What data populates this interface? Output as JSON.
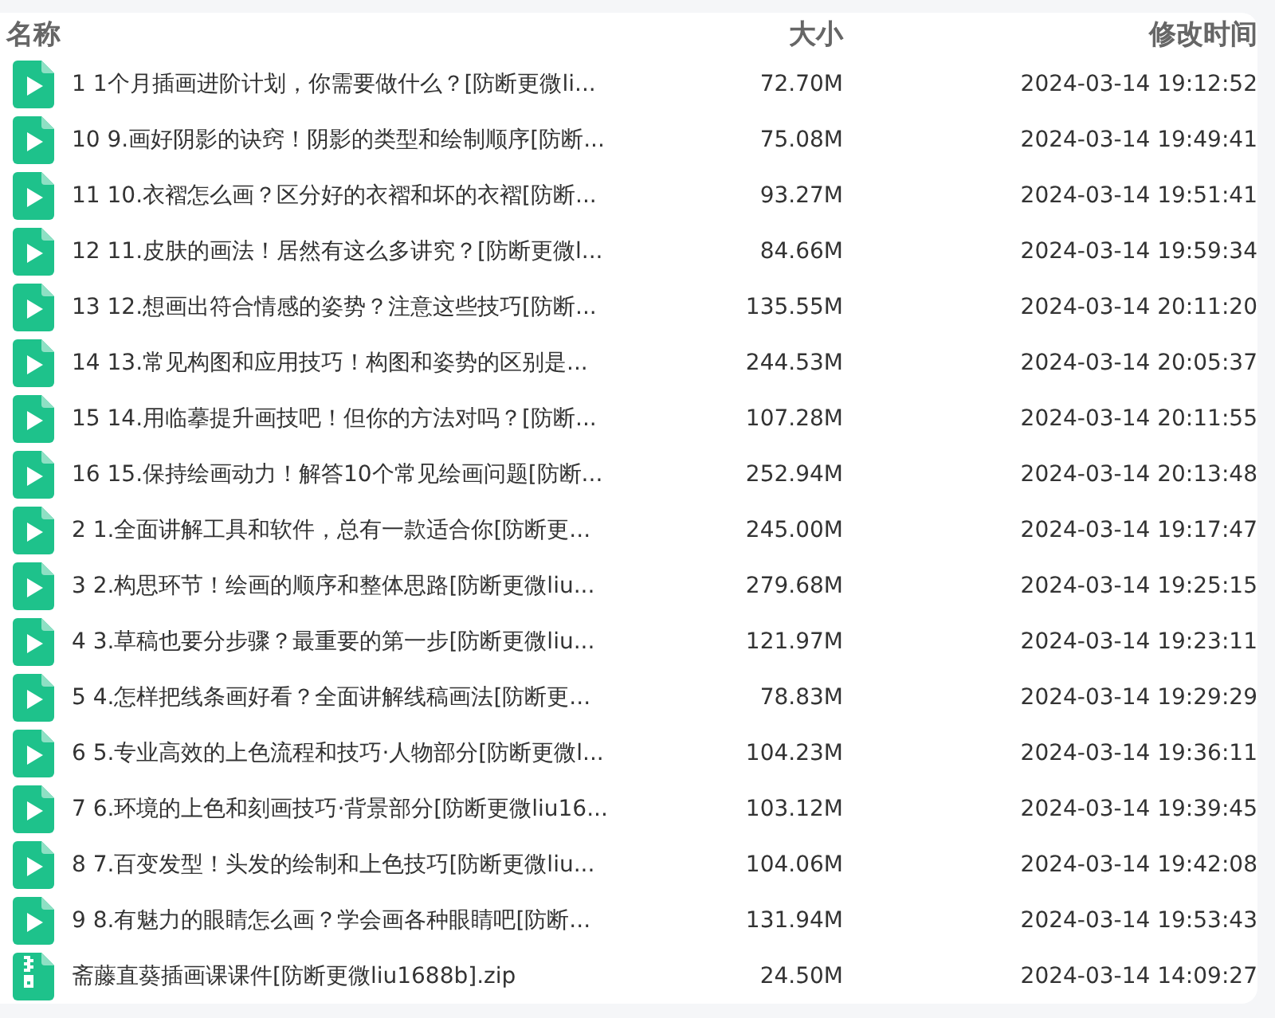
{
  "table": {
    "columns": [
      "名称",
      "大小",
      "修改时间"
    ],
    "rows": [
      {
        "kind": "video",
        "name": "1 1个月插画进阶计划，你需要做什么？[防断更微li...",
        "size": "72.70M",
        "modified": "2024-03-14 19:12:52"
      },
      {
        "kind": "video",
        "name": "10 9.画好阴影的诀窍！阴影的类型和绘制顺序[防断...",
        "size": "75.08M",
        "modified": "2024-03-14 19:49:41"
      },
      {
        "kind": "video",
        "name": "11 10.衣褶怎么画？区分好的衣褶和坏的衣褶[防断...",
        "size": "93.27M",
        "modified": "2024-03-14 19:51:41"
      },
      {
        "kind": "video",
        "name": "12 11.皮肤的画法！居然有这么多讲究？[防断更微l...",
        "size": "84.66M",
        "modified": "2024-03-14 19:59:34"
      },
      {
        "kind": "video",
        "name": "13 12.想画出符合情感的姿势？注意这些技巧[防断...",
        "size": "135.55M",
        "modified": "2024-03-14 20:11:20"
      },
      {
        "kind": "video",
        "name": "14 13.常见构图和应用技巧！构图和姿势的区别是...",
        "size": "244.53M",
        "modified": "2024-03-14 20:05:37"
      },
      {
        "kind": "video",
        "name": "15 14.用临摹提升画技吧！但你的方法对吗？[防断...",
        "size": "107.28M",
        "modified": "2024-03-14 20:11:55"
      },
      {
        "kind": "video",
        "name": "16 15.保持绘画动力！解答10个常见绘画问题[防断...",
        "size": "252.94M",
        "modified": "2024-03-14 20:13:48"
      },
      {
        "kind": "video",
        "name": "2 1.全面讲解工具和软件，总有一款适合你[防断更...",
        "size": "245.00M",
        "modified": "2024-03-14 19:17:47"
      },
      {
        "kind": "video",
        "name": "3 2.构思环节！绘画的顺序和整体思路[防断更微liu...",
        "size": "279.68M",
        "modified": "2024-03-14 19:25:15"
      },
      {
        "kind": "video",
        "name": "4 3.草稿也要分步骤？最重要的第一步[防断更微liu...",
        "size": "121.97M",
        "modified": "2024-03-14 19:23:11"
      },
      {
        "kind": "video",
        "name": "5 4.怎样把线条画好看？全面讲解线稿画法[防断更...",
        "size": "78.83M",
        "modified": "2024-03-14 19:29:29"
      },
      {
        "kind": "video",
        "name": "6 5.专业高效的上色流程和技巧·人物部分[防断更微l...",
        "size": "104.23M",
        "modified": "2024-03-14 19:36:11"
      },
      {
        "kind": "video",
        "name": "7 6.环境的上色和刻画技巧·背景部分[防断更微liu16...",
        "size": "103.12M",
        "modified": "2024-03-14 19:39:45"
      },
      {
        "kind": "video",
        "name": "8 7.百变发型！头发的绘制和上色技巧[防断更微liu...",
        "size": "104.06M",
        "modified": "2024-03-14 19:42:08"
      },
      {
        "kind": "video",
        "name": "9 8.有魅力的眼睛怎么画？学会画各种眼睛吧[防断...",
        "size": "131.94M",
        "modified": "2024-03-14 19:53:43"
      },
      {
        "kind": "zip",
        "name": "斋藤直葵插画课课件[防断更微liu1688b].zip",
        "size": "24.50M",
        "modified": "2024-03-14 14:09:27"
      }
    ]
  }
}
